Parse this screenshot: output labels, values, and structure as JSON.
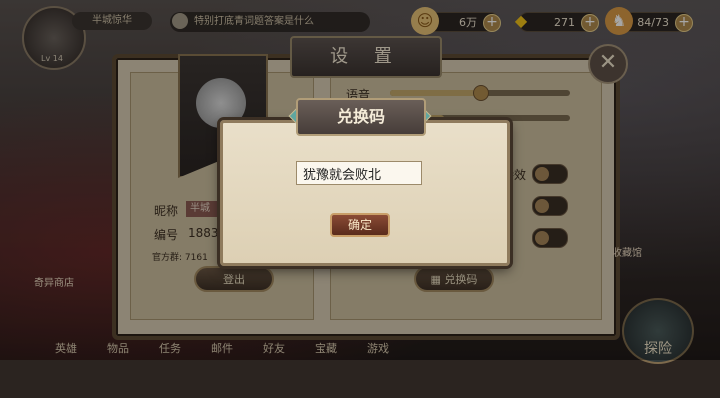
{
  "hud": {
    "player_name": "半城惊华",
    "level": "Lv 14",
    "chat_text": "特别打底青词题答案是什么",
    "coins": "6万",
    "gems": "271",
    "stamina": "84/73"
  },
  "settings": {
    "title": "设 置",
    "voice_label": "语音",
    "effects_label": "特效",
    "nickname_label": "昵称",
    "nickname_value": "半城",
    "id_label": "编号",
    "id_value": "1883",
    "group_label": "官方群: 7161",
    "logout_button": "登出",
    "redeem_button": "兑换码",
    "voice_level": 0.5
  },
  "modal": {
    "title": "兑换码",
    "input_value": "犹豫就会败北",
    "confirm_button": "确定"
  },
  "bottom_tabs": [
    "英雄",
    "物品",
    "任务",
    "邮件",
    "好友",
    "宝藏",
    "游戏"
  ],
  "side_labels": {
    "shop": "奇异商店",
    "collection": "收藏馆"
  },
  "explore_button": "探险"
}
